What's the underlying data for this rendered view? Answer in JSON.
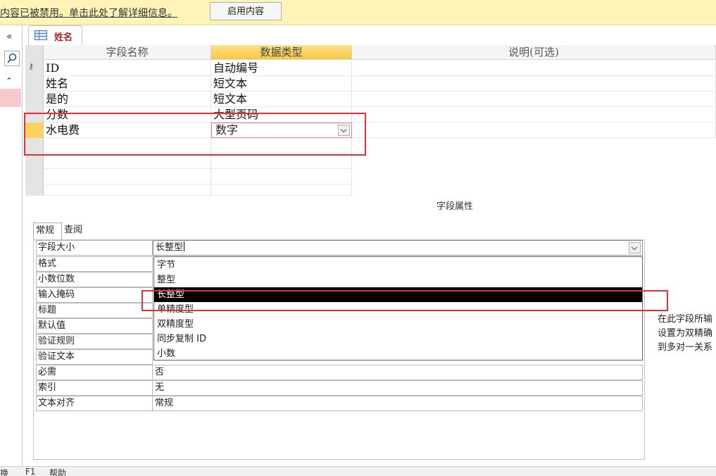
{
  "security_bar": {
    "message": "内容已被禁用。单击此处了解详细信息。",
    "enable_button": "启用内容"
  },
  "nav": {
    "collapse_glyph": "«",
    "expand_glyph": "⌃"
  },
  "tab": {
    "label": "姓名"
  },
  "design_grid": {
    "headers": [
      "字段名称",
      "数据类型",
      "说明(可选)"
    ],
    "rows": [
      {
        "name": "ID",
        "type": "自动编号"
      },
      {
        "name": "姓名",
        "type": "短文本"
      },
      {
        "name": "是的",
        "type": "短文本"
      },
      {
        "name": "分数",
        "type": "大型页码"
      },
      {
        "name": "水电费",
        "type": "数字"
      }
    ]
  },
  "properties": {
    "title": "字段属性",
    "tabs": [
      "常规",
      "查阅"
    ],
    "rows": [
      {
        "label": "字段大小",
        "value": "长整型"
      },
      {
        "label": "格式",
        "value": ""
      },
      {
        "label": "小数位数",
        "value": ""
      },
      {
        "label": "输入掩码",
        "value": ""
      },
      {
        "label": "标题",
        "value": ""
      },
      {
        "label": "默认值",
        "value": ""
      },
      {
        "label": "验证规则",
        "value": ""
      },
      {
        "label": "验证文本",
        "value": ""
      },
      {
        "label": "必需",
        "value": "否"
      },
      {
        "label": "索引",
        "value": "无"
      },
      {
        "label": "文本对齐",
        "value": "常规"
      }
    ],
    "size_options": [
      "字节",
      "整型",
      "长整型",
      "单精度型",
      "双精度型",
      "同步复制 ID",
      "小数"
    ],
    "selected_option": "长整型",
    "description_lines": [
      "在此字段所输",
      "设置为双精确",
      "到多对一关系"
    ]
  },
  "status_bar": {
    "left": "换",
    "mid": "F1",
    "help": "帮助"
  },
  "colors": {
    "highlight_box": "#e0323c",
    "current_row_marker": "#fbd35c",
    "active_tab_text": "#a4262c"
  }
}
